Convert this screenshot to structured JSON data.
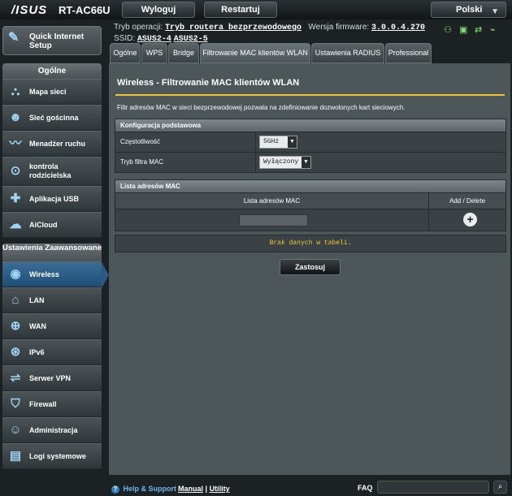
{
  "header": {
    "logo": "/ISUS",
    "model": "RT-AC66U",
    "logout": "Wyloguj",
    "restart": "Restartuj",
    "language": "Polski"
  },
  "status": {
    "mode_label": "Tryb operacji:",
    "mode_value": "Tryb routera bezprzewodowego",
    "firmware_label": "Wersja firmware:",
    "firmware_value": "3.0.0.4.270",
    "ssid_label": "SSID:",
    "ssid1": "ASUS2-4",
    "ssid2": "ASUS2-5"
  },
  "sidebar": {
    "quick_internet": "Quick Internet Setup",
    "general_header": "Ogólne",
    "general_items": [
      {
        "label": "Mapa sieci",
        "icon": "network-map-icon"
      },
      {
        "label": "Sieć gościnna",
        "icon": "guest-network-icon"
      },
      {
        "label": "Menadżer ruchu",
        "icon": "traffic-manager-icon"
      },
      {
        "label": "kontrola rodzicielska",
        "icon": "parental-control-icon"
      },
      {
        "label": "Aplikacja USB",
        "icon": "usb-icon"
      },
      {
        "label": "AiCloud",
        "icon": "cloud-icon"
      }
    ],
    "advanced_header": "Ustawienia Zaawansowane",
    "advanced_items": [
      {
        "label": "Wireless",
        "icon": "wifi-icon"
      },
      {
        "label": "LAN",
        "icon": "home-icon"
      },
      {
        "label": "WAN",
        "icon": "globe-icon"
      },
      {
        "label": "IPv6",
        "icon": "ipv6-icon"
      },
      {
        "label": "Serwer VPN",
        "icon": "vpn-icon"
      },
      {
        "label": "Firewall",
        "icon": "shield-icon"
      },
      {
        "label": "Administracja",
        "icon": "admin-icon"
      },
      {
        "label": "Logi systemowe",
        "icon": "log-icon"
      }
    ]
  },
  "tabs": [
    "Ogólne",
    "WPS",
    "Bridge",
    "Filtrowanie MAC klientów WLAN",
    "Ustawienia RADIUS",
    "Professional"
  ],
  "main": {
    "title": "Wireless - Filtrowanie MAC klientów WLAN",
    "description": "Filtr adresów MAC w sieci bezprzewodowej pozwala na zdefiniowanie dozwolonych kart sieciowych.",
    "basic_header": "Konfiguracja podstawowa",
    "frequency_label": "Częstotliwość",
    "frequency_value": "5GHz",
    "filter_mode_label": "Tryb filtra MAC",
    "filter_mode_value": "Wyłączony",
    "mac_list_header": "Lista adresów MAC",
    "col_mac": "Lista adresów MAC",
    "col_add": "Add / Delete",
    "no_data": "Brak danych w tabeli.",
    "apply": "Zastosuj"
  },
  "footer": {
    "help": "Help & Support",
    "manual": "Manual",
    "separator": "|",
    "utility": "Utility",
    "faq": "FAQ"
  }
}
